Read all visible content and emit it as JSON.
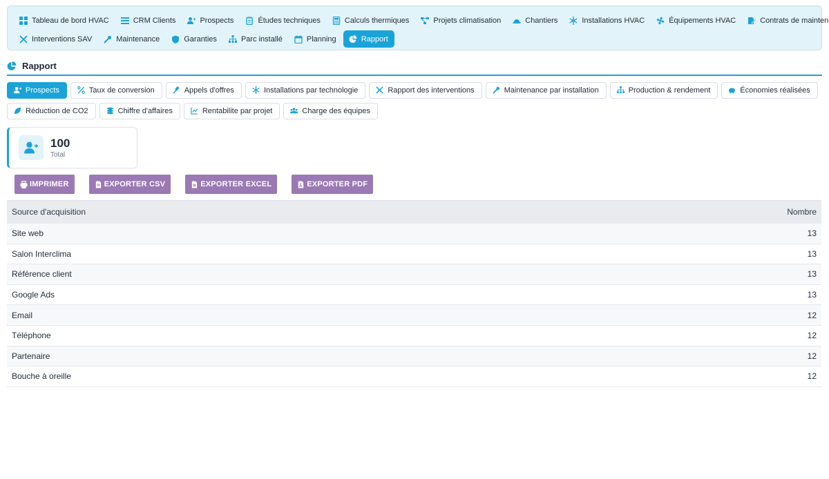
{
  "nav": {
    "items": [
      {
        "label": "Tableau de bord HVAC",
        "icon": "dashboard-icon"
      },
      {
        "label": "CRM Clients",
        "icon": "list-icon"
      },
      {
        "label": "Prospects",
        "icon": "user-plus-icon"
      },
      {
        "label": "Études techniques",
        "icon": "clipboard-icon"
      },
      {
        "label": "Calculs thermiques",
        "icon": "calculator-icon"
      },
      {
        "label": "Projets climatisation",
        "icon": "project-diagram-icon"
      },
      {
        "label": "Chantiers",
        "icon": "hard-hat-icon"
      },
      {
        "label": "Installations HVAC",
        "icon": "snowflake-icon"
      },
      {
        "label": "Équipements HVAC",
        "icon": "fan-icon"
      },
      {
        "label": "Contrats de maintenance",
        "icon": "contract-icon"
      },
      {
        "label": "Interventions SAV",
        "icon": "tools-icon"
      },
      {
        "label": "Maintenance",
        "icon": "wrench-icon"
      },
      {
        "label": "Garanties",
        "icon": "shield-icon"
      },
      {
        "label": "Parc installé",
        "icon": "sitemap-icon"
      },
      {
        "label": "Planning",
        "icon": "calendar-icon"
      },
      {
        "label": "Rapport",
        "icon": "chart-pie-icon"
      }
    ],
    "active_index": 15
  },
  "section": {
    "title": "Rapport"
  },
  "subtabs": {
    "items": [
      {
        "label": "Prospects",
        "icon": "user-plus-icon"
      },
      {
        "label": "Taux de conversion",
        "icon": "percent-icon"
      },
      {
        "label": "Appels d'offres",
        "icon": "gavel-icon"
      },
      {
        "label": "Installations par technologie",
        "icon": "snowflake-icon"
      },
      {
        "label": "Rapport des interventions",
        "icon": "tools-icon"
      },
      {
        "label": "Maintenance par installation",
        "icon": "wrench-icon"
      },
      {
        "label": "Production & rendement",
        "icon": "sitemap-icon"
      },
      {
        "label": "Économies réalisées",
        "icon": "piggy-bank-icon"
      },
      {
        "label": "Réduction de CO2",
        "icon": "leaf-icon"
      },
      {
        "label": "Chiffre d'affaires",
        "icon": "coins-icon"
      },
      {
        "label": "Rentabilite par projet",
        "icon": "chart-line-icon"
      },
      {
        "label": "Charge des équipes",
        "icon": "users-icon"
      }
    ],
    "active_index": 0
  },
  "stat": {
    "value": "100",
    "label": "Total",
    "icon": "user-plus-icon"
  },
  "export": {
    "print_label": "IMPRIMER",
    "csv_label": "EXPORTER CSV",
    "excel_label": "EXPORTER EXCEL",
    "pdf_label": "EXPORTER PDF"
  },
  "table": {
    "headers": [
      "Source d'acquisition",
      "Nombre"
    ],
    "rows": [
      [
        "Site web",
        "13"
      ],
      [
        "Salon Interclima",
        "13"
      ],
      [
        "Référence client",
        "13"
      ],
      [
        "Google Ads",
        "13"
      ],
      [
        "Email",
        "12"
      ],
      [
        "Téléphone",
        "12"
      ],
      [
        "Partenaire",
        "12"
      ],
      [
        "Bouche à oreille",
        "12"
      ]
    ]
  },
  "colors": {
    "accent": "#1aa3d9",
    "export_button": "#9b79b4",
    "nav_background": "#e3f3fa"
  }
}
